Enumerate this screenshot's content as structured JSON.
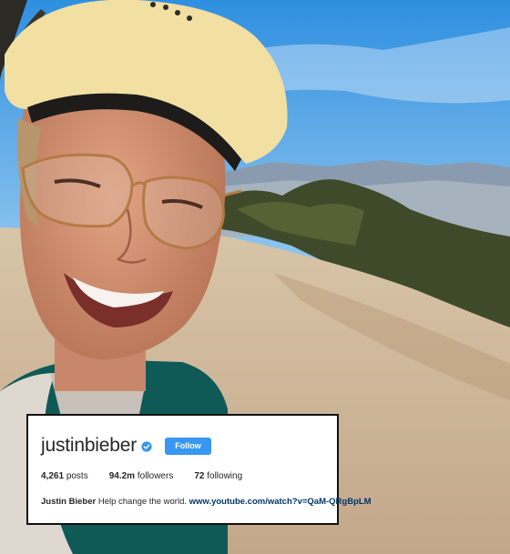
{
  "profile": {
    "username": "justinbieber",
    "verified_icon": "verified-badge-icon",
    "follow_label": "Follow",
    "posts_count": "4,261",
    "posts_label": "posts",
    "followers_count": "94.2m",
    "followers_label": "followers",
    "following_count": "72",
    "following_label": "following",
    "bio_name": "Justin Bieber",
    "bio_text": "Help change the world.",
    "bio_link": "www.youtube.com/watch?v=QaM-QRgBpLM"
  },
  "colors": {
    "follow_button": "#3897f0",
    "verified_badge": "#3897f0",
    "link": "#003569"
  }
}
